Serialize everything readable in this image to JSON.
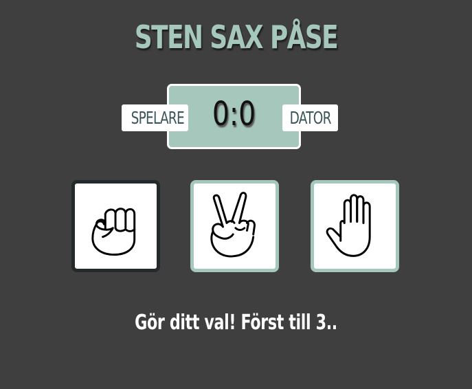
{
  "game": {
    "title": "STEN SAX PÅSE",
    "message": "Gör ditt val! Först till 3.."
  },
  "scoreboard": {
    "player_label": "SPELARE",
    "computer_label": "DATOR",
    "score_text": "0:0",
    "player_score": 0,
    "computer_score": 0
  },
  "choices": [
    {
      "name": "rock",
      "icon": "fist-hand-icon",
      "selected": true
    },
    {
      "name": "scissors",
      "icon": "peace-hand-icon",
      "selected": false
    },
    {
      "name": "paper",
      "icon": "open-hand-icon",
      "selected": false
    }
  ],
  "colors": {
    "background": "#3f3f3f",
    "accent": "#a6c7bb",
    "selected_border": "#232a2c",
    "badge_text": "#3b5558"
  }
}
